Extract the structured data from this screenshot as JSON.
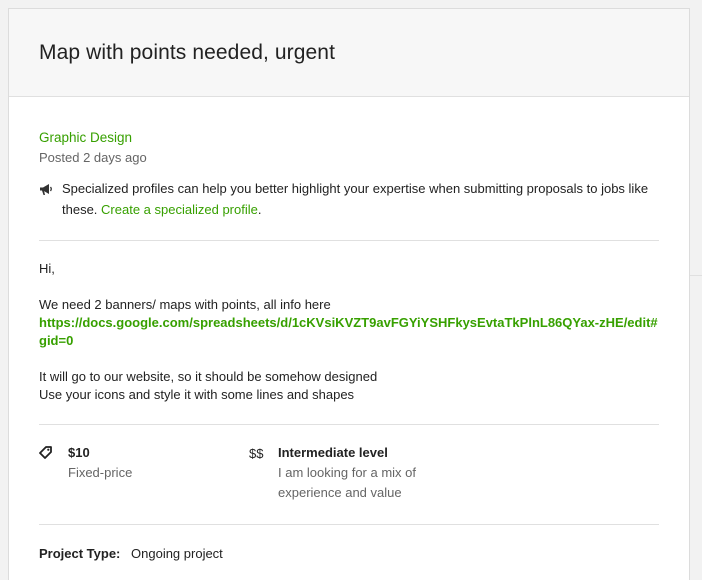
{
  "job": {
    "title": "Map with points needed, urgent",
    "category": "Graphic Design",
    "posted": "Posted 2 days ago"
  },
  "notice": {
    "icon": "megaphone-icon",
    "text": "Specialized profiles can help you better highlight your expertise when submitting proposals to jobs like these.",
    "link_text": "Create a specialized profile",
    "after_link": "."
  },
  "description": {
    "greeting": "Hi,",
    "line1": "We need 2 banners/ maps with points, all info here",
    "link": "https://docs.google.com/spreadsheets/d/1cKVsiKVZT9avFGYiYSHFkysEvtaTkPlnL86QYax-zHE/edit#gid=0",
    "line2": "It will go to our website, so it should be somehow designed",
    "line3": "Use your icons and style it with some lines and shapes"
  },
  "features": {
    "price": {
      "icon": "price-tag-icon",
      "value": "$10",
      "label": "Fixed-price"
    },
    "level": {
      "icon_text": "$$",
      "title": "Intermediate level",
      "description": "I am looking for a mix of experience and value"
    }
  },
  "project_type": {
    "label": "Project Type:",
    "value": "Ongoing project"
  },
  "colors": {
    "accent": "#37a000",
    "muted": "#656565",
    "header_bg": "#f7f7f7"
  }
}
